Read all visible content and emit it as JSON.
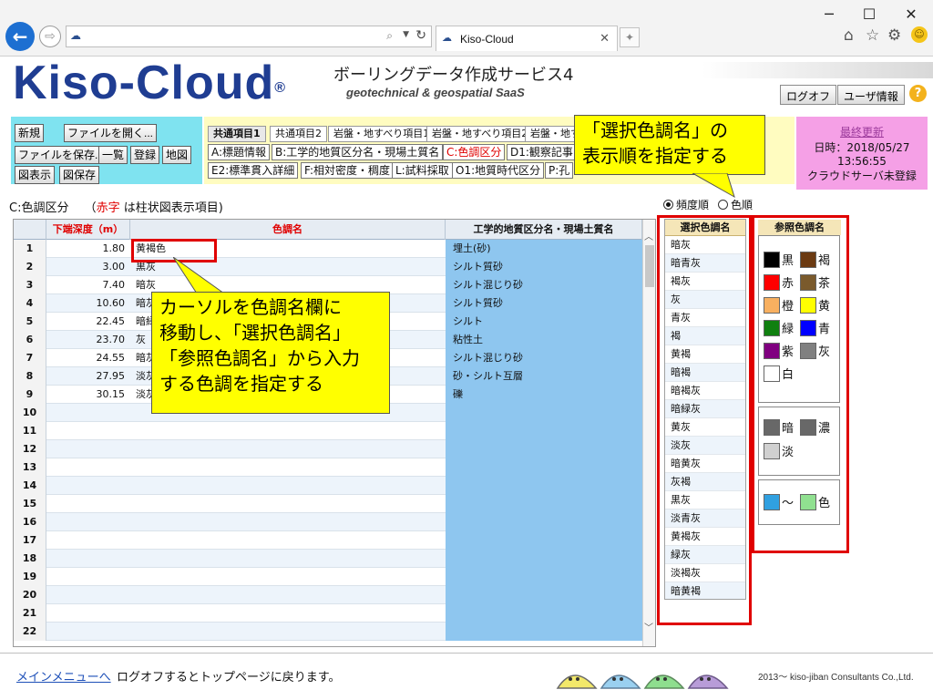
{
  "browser": {
    "tab_title": "Kiso-Cloud",
    "newtab_symbol": "✦"
  },
  "site": {
    "logo": "Kiso-Cloud",
    "logo_mark": "®",
    "service_title": "ボーリングデータ作成サービス4",
    "service_sub": "geotechnical & geospatial SaaS",
    "logoff": "ログオフ",
    "user_info": "ユーザ情報",
    "help": "?"
  },
  "toolbar": {
    "file_buttons": [
      "新規",
      "ファイルを開く...",
      "ファイルを保存...",
      "一覧",
      "登録",
      "地図",
      "図表示",
      "図保存"
    ],
    "upper_tabs": [
      "共通項目1",
      "共通項目2",
      "岩盤・地すべり項目1",
      "岩盤・地すべり項目2",
      "岩盤・地す"
    ],
    "row1": [
      "A:標題情報",
      "B:工学的地質区分名・現場土質名",
      "C:色調区分",
      "D1:観察記事"
    ],
    "row2": [
      "E2:標準貫入詳細",
      "F:相対密度・稠度",
      "L:試料採取",
      "O1:地質時代区分",
      "P:孔"
    ],
    "update_label": "最終更新",
    "update_date": "日時：2018/05/27",
    "update_time": "13:56:55",
    "update_status": "クラウドサーバ未登録"
  },
  "callouts": {
    "top_line1": "「選択色調名」の",
    "top_line2": "表示順を指定する",
    "mid_line1": "カーソルを色調名欄に",
    "mid_line2": "移動し、「選択色調名」",
    "mid_line3": "「参照色調名」から入力",
    "mid_line4": "する色調を指定する"
  },
  "section": {
    "title": "C:色調区分",
    "paren_open": "（",
    "red_word": "赤字",
    "note": "は柱状図表示項目)"
  },
  "sort": {
    "freq": "頻度順",
    "color": "色順",
    "selected": "freq"
  },
  "grid": {
    "headers": {
      "depth": "下端深度（m）",
      "color": "色調名",
      "soil": "工学的地質区分名・現場土質名"
    },
    "rows": [
      {
        "no": "1",
        "depth": "1.80",
        "color": "黄褐色",
        "soil": "埋土(砂)"
      },
      {
        "no": "2",
        "depth": "3.00",
        "color": "黒灰",
        "soil": "シルト質砂"
      },
      {
        "no": "3",
        "depth": "7.40",
        "color": "暗灰",
        "soil": "シルト混じり砂"
      },
      {
        "no": "4",
        "depth": "10.60",
        "color": "暗灰",
        "soil": "シルト質砂"
      },
      {
        "no": "5",
        "depth": "22.45",
        "color": "暗緑",
        "soil": "シルト"
      },
      {
        "no": "6",
        "depth": "23.70",
        "color": "灰",
        "soil": "粘性土"
      },
      {
        "no": "7",
        "depth": "24.55",
        "color": "暗灰",
        "soil": "シルト混じり砂"
      },
      {
        "no": "8",
        "depth": "27.95",
        "color": "淡灰",
        "soil": "砂・シルト互層"
      },
      {
        "no": "9",
        "depth": "30.15",
        "color": "淡灰",
        "soil": "礫"
      },
      {
        "no": "10",
        "depth": "",
        "color": "",
        "soil": ""
      },
      {
        "no": "11",
        "depth": "",
        "color": "",
        "soil": ""
      },
      {
        "no": "12",
        "depth": "",
        "color": "",
        "soil": ""
      },
      {
        "no": "13",
        "depth": "",
        "color": "",
        "soil": ""
      },
      {
        "no": "14",
        "depth": "",
        "color": "",
        "soil": ""
      },
      {
        "no": "15",
        "depth": "",
        "color": "",
        "soil": ""
      },
      {
        "no": "16",
        "depth": "",
        "color": "",
        "soil": ""
      },
      {
        "no": "17",
        "depth": "",
        "color": "",
        "soil": ""
      },
      {
        "no": "18",
        "depth": "",
        "color": "",
        "soil": ""
      },
      {
        "no": "19",
        "depth": "",
        "color": "",
        "soil": ""
      },
      {
        "no": "20",
        "depth": "",
        "color": "",
        "soil": ""
      },
      {
        "no": "21",
        "depth": "",
        "color": "",
        "soil": ""
      },
      {
        "no": "22",
        "depth": "",
        "color": "",
        "soil": ""
      }
    ]
  },
  "selection": {
    "header": "選択色調名",
    "items": [
      "暗灰",
      "暗青灰",
      "褐灰",
      "灰",
      "青灰",
      "褐",
      "黄褐",
      "暗褐",
      "暗褐灰",
      "暗緑灰",
      "黄灰",
      "淡灰",
      "暗黄灰",
      "灰褐",
      "黒灰",
      "淡青灰",
      "黄褐灰",
      "緑灰",
      "淡褐灰",
      "暗黄褐"
    ]
  },
  "reference": {
    "header": "参照色調名",
    "colors": [
      {
        "name": "黒",
        "hex": "#000000"
      },
      {
        "name": "褐",
        "hex": "#6b3a12"
      },
      {
        "name": "赤",
        "hex": "#ff0000"
      },
      {
        "name": "茶",
        "hex": "#7a5a2c"
      },
      {
        "name": "橙",
        "hex": "#f8b060"
      },
      {
        "name": "黄",
        "hex": "#ffff00"
      },
      {
        "name": "緑",
        "hex": "#108010"
      },
      {
        "name": "青",
        "hex": "#0000ff"
      },
      {
        "name": "紫",
        "hex": "#800080"
      },
      {
        "name": "灰",
        "hex": "#808080"
      },
      {
        "name": "白",
        "hex": "#ffffff"
      }
    ],
    "shade": [
      {
        "name": "暗",
        "hex": "#686868"
      },
      {
        "name": "濃",
        "hex": "#686868"
      },
      {
        "name": "淡",
        "hex": "#d0d0d0"
      }
    ],
    "mix": [
      {
        "name": "～",
        "hex": "#30a0e0"
      },
      {
        "name": "色",
        "hex": "#90e090"
      }
    ]
  },
  "footer": {
    "link": "メインメニューへ",
    "text": "ログオフするとトップページに戻ります。",
    "copyright": "2013～ kiso-jiban Consultants Co.,Ltd."
  }
}
